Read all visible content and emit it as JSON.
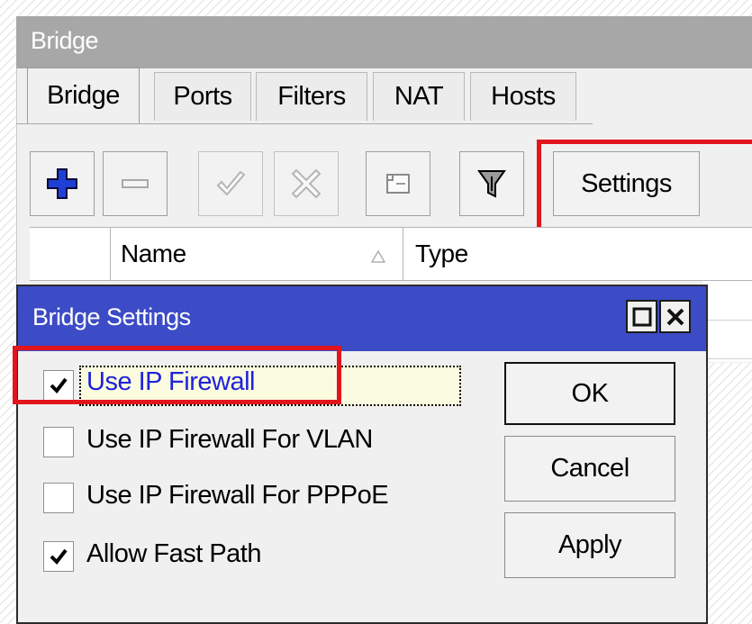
{
  "bridge_window": {
    "title": "Bridge",
    "tabs": [
      "Bridge",
      "Ports",
      "Filters",
      "NAT",
      "Hosts"
    ],
    "active_tab": "Bridge",
    "toolbar": {
      "add_icon": "plus-icon",
      "remove_icon": "minus-icon",
      "enable_icon": "check-icon",
      "disable_icon": "cross-icon",
      "comment_icon": "comment-icon",
      "filter_icon": "filter-funnel-icon",
      "settings_label": "Settings"
    },
    "table": {
      "columns": [
        "Name",
        "Type"
      ],
      "sort_column": "Name"
    }
  },
  "dialog": {
    "title": "Bridge Settings",
    "window_buttons": [
      "maximize-icon",
      "close-icon"
    ],
    "options": [
      {
        "label": "Use IP Firewall",
        "checked": true,
        "focused": true
      },
      {
        "label": "Use IP Firewall For VLAN",
        "checked": false
      },
      {
        "label": "Use IP Firewall For PPPoE",
        "checked": false
      },
      {
        "label": "Allow Fast Path",
        "checked": true
      }
    ],
    "buttons": {
      "ok": "OK",
      "cancel": "Cancel",
      "apply": "Apply"
    }
  },
  "colors": {
    "dialog_titlebar": "#3c4bc6",
    "window_titlebar": "#a7a7a7",
    "highlight": "#e2141c",
    "focused_label": "#1f22d8"
  }
}
